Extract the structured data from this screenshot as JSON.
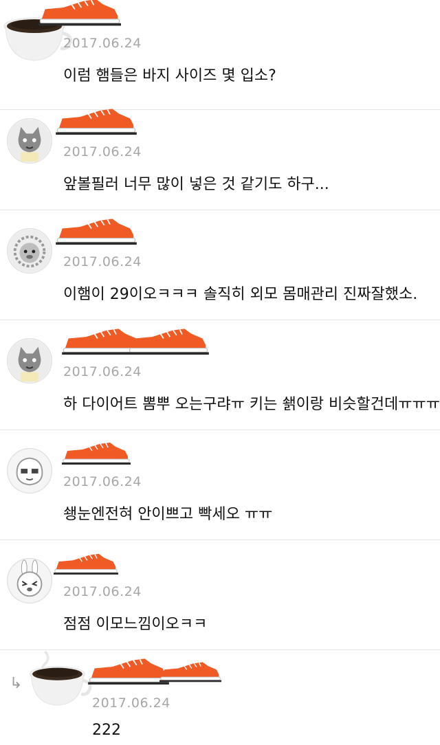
{
  "comments": [
    {
      "date": "2017.06.24",
      "text": "이럼 햄들은 바지 사이즈 몇 입소?",
      "avatar": "coffee-cup-icon"
    },
    {
      "date": "2017.06.24",
      "text": "앞볼필러 너무 많이 넣은 것 같기도 하구...",
      "avatar": "cat-avatar-icon"
    },
    {
      "date": "2017.06.24",
      "text": "이햄이 29이오ㅋㅋㅋ 솔직히 외모 몸매관리 진짜잘했소.",
      "avatar": "lion-avatar-icon"
    },
    {
      "date": "2017.06.24",
      "text": "하 다이어트 뽐뿌 오는구랴ㅠ 키는 쇍이랑 비슷할건데ㅠㅠㅠ",
      "avatar": "cat-avatar-icon"
    },
    {
      "date": "2017.06.24",
      "text": "쇙눈엔전혀 안이쁘고 빡세오 ㅠㅠ",
      "avatar": "peach-avatar-icon"
    },
    {
      "date": "2017.06.24",
      "text": "점점 이모느낌이오ㅋㅋ",
      "avatar": "rabbit-avatar-icon"
    }
  ],
  "reply": {
    "date": "2017.06.24",
    "text": "222",
    "avatar": "coffee-cup-icon",
    "arrow": "↳"
  },
  "colors": {
    "shoe": "#f05a24",
    "date": "#a6a6a6",
    "text": "#111111",
    "divider": "#e6e6e6"
  }
}
